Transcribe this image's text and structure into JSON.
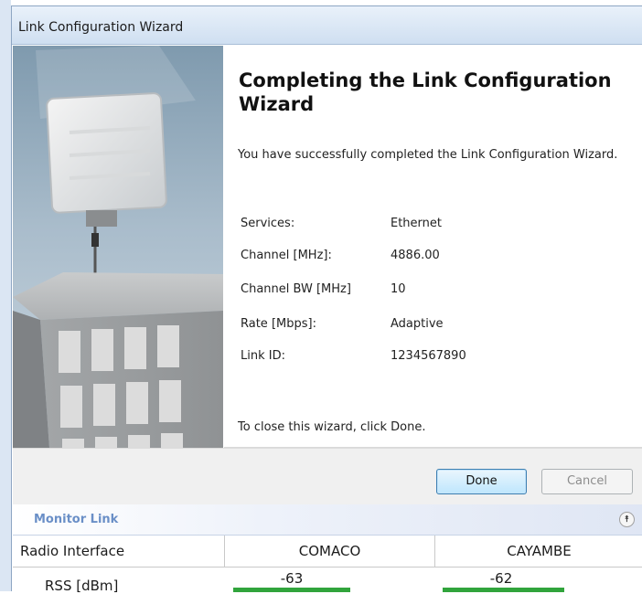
{
  "window": {
    "title": "Link Configuration Wizard"
  },
  "wizard": {
    "heading": "Completing the Link Configuration Wizard",
    "intro": "You have successfully completed the Link Configuration Wizard.",
    "summary": [
      {
        "label": "Services:",
        "value": "Ethernet"
      },
      {
        "label": "Channel [MHz]:",
        "value": "4886.00"
      },
      {
        "label": "Channel BW [MHz]",
        "value": "10"
      },
      {
        "label": "Rate [Mbps]:",
        "value": "Adaptive"
      },
      {
        "label": "Link ID:",
        "value": "1234567890"
      }
    ],
    "close_instruction": "To close this wizard, click Done."
  },
  "buttons": {
    "done": "Done",
    "cancel": "Cancel"
  },
  "monitor": {
    "title": "Monitor Link",
    "collapse_icon": "double-chevron-up-icon",
    "columns": [
      "Radio Interface",
      "COMACO",
      "CAYAMBE"
    ],
    "rows": [
      {
        "label": "RSS [dBm]",
        "values": [
          "-63",
          "-62"
        ]
      }
    ]
  },
  "colors": {
    "accent": "#6a8fc7",
    "signal_bar": "#31a43c"
  }
}
